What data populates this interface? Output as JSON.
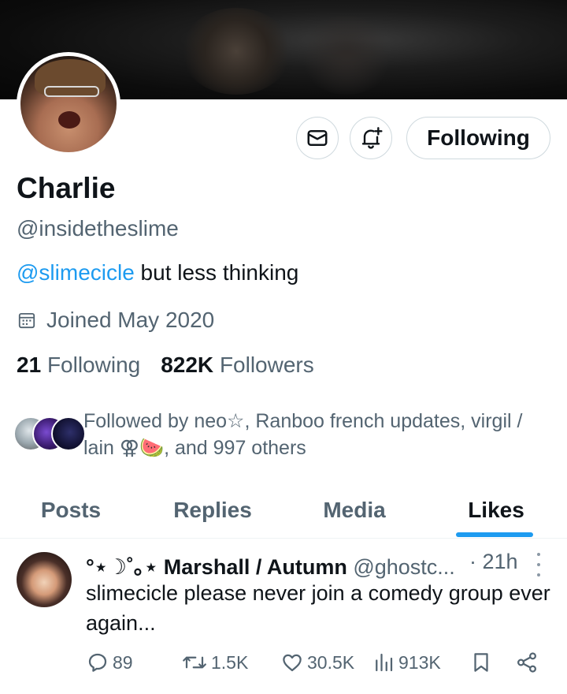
{
  "profile": {
    "name": "Charlie",
    "handle": "@insidetheslime",
    "bio_mention": "@slimecicle",
    "bio_text": " but less thinking",
    "joined": "Joined May 2020",
    "following_count": "21",
    "following_label": "Following",
    "followers_count": "822K",
    "followers_label": "Followers",
    "followed_by": "Followed by neo☆, Ranboo french updates, virgil / lain ⚢🍉, and 997 others"
  },
  "buttons": {
    "message_icon": "envelope-icon",
    "notify_icon": "bell-plus-icon",
    "following_label": "Following"
  },
  "tabs": [
    {
      "label": "Posts",
      "active": false
    },
    {
      "label": "Replies",
      "active": false
    },
    {
      "label": "Media",
      "active": false
    },
    {
      "label": "Likes",
      "active": true
    }
  ],
  "post": {
    "author": "°⋆☽˚｡⋆ Marshall / Autumn",
    "handle": "@ghostc...",
    "time": "· 21h",
    "text": "slimecicle please never join a comedy group ever again...",
    "replies": "89",
    "reposts": "1.5K",
    "likes": "30.5K",
    "views": "913K"
  },
  "colors": {
    "accent": "#1d9bf0",
    "text": "#0f1419",
    "muted": "#536471",
    "border": "#cfd9de"
  }
}
